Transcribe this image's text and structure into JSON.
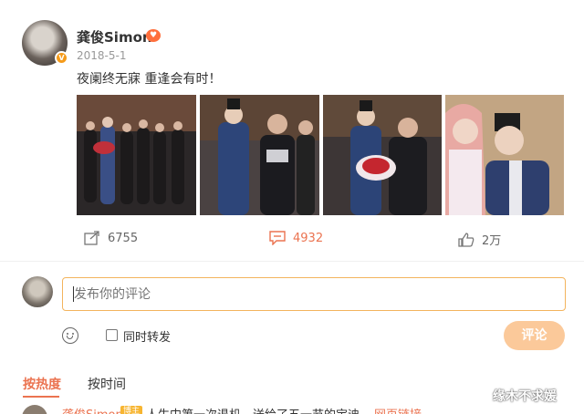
{
  "post": {
    "username": "龚俊Simon",
    "date": "2018-5-1",
    "text": "夜阑终无寐 重逢会有时！",
    "photo_count": 4
  },
  "actions": {
    "share_count": "6755",
    "comment_count": "4932",
    "like_count": "2万"
  },
  "composer": {
    "placeholder": "发布你的评论",
    "repost_label": "同时转发",
    "submit_label": "评论"
  },
  "sort": {
    "hot_label": "按热度",
    "time_label": "按时间"
  },
  "first_comment": {
    "user": "龚俊Simon",
    "tag": "博主",
    "text": "人生中第一次退机，送给了五一节的宝迪",
    "link": "网页链接"
  },
  "watermark": "缘木不求媛",
  "colors": {
    "accent": "#eb7350",
    "input_border": "#f3b45d",
    "submit_bg": "#fbc99a"
  }
}
